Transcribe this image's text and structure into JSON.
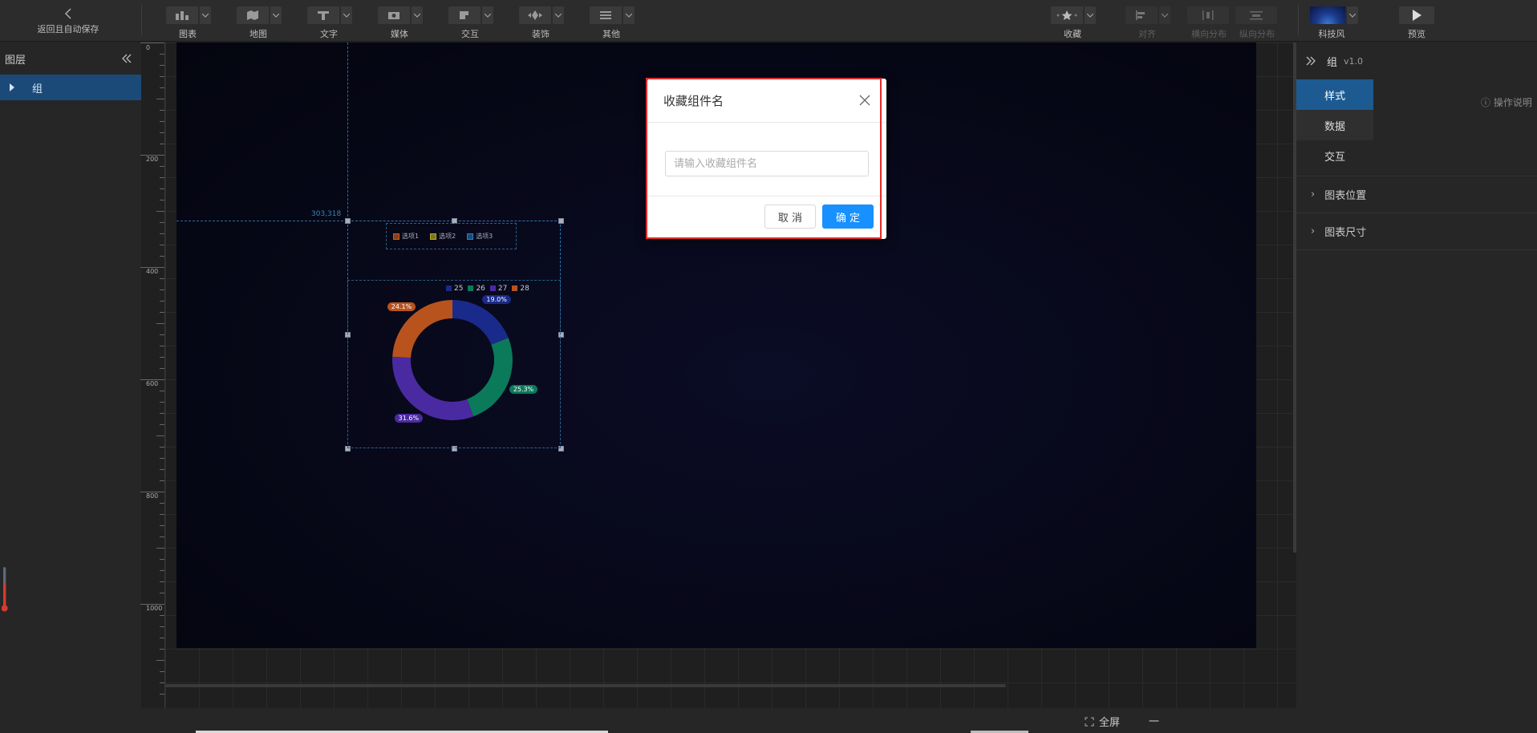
{
  "toolbar": {
    "back_label": "返回且自动保存",
    "groups": [
      {
        "label": "图表",
        "icon": "chart-icon"
      },
      {
        "label": "地图",
        "icon": "map-icon"
      },
      {
        "label": "文字",
        "icon": "text-icon"
      },
      {
        "label": "媒体",
        "icon": "media-icon"
      },
      {
        "label": "交互",
        "icon": "interact-icon"
      },
      {
        "label": "装饰",
        "icon": "decoration-icon"
      },
      {
        "label": "其他",
        "icon": "other-icon"
      }
    ],
    "right_groups": [
      {
        "label": "收藏",
        "icon": "star-icon"
      },
      {
        "label": "对齐",
        "icon": "align-icon"
      },
      {
        "label": "横向分布",
        "icon": "h-distribute-icon"
      },
      {
        "label": "纵向分布",
        "icon": "v-distribute-icon"
      },
      {
        "label": "科技风",
        "icon": "theme-thumbnail"
      },
      {
        "label": "预览",
        "icon": "play-icon"
      }
    ]
  },
  "layers": {
    "title": "图层",
    "items": [
      {
        "label": "组"
      }
    ]
  },
  "ruler": {
    "marks": [
      "0",
      "200",
      "400",
      "600",
      "800",
      "1000"
    ]
  },
  "canvas": {
    "coord_readout": "303,318",
    "legend_top": [
      {
        "label": "选项1",
        "color": "#c0602a"
      },
      {
        "label": "选项2",
        "color": "#b8a92c"
      },
      {
        "label": "选项3",
        "color": "#2b7fc4"
      }
    ]
  },
  "chart_data": {
    "type": "pie",
    "donut": true,
    "categories": [
      "25",
      "26",
      "27",
      "28"
    ],
    "values": [
      19.0,
      25.3,
      31.6,
      24.1
    ],
    "labels": [
      "19.0%",
      "25.3%",
      "31.6%",
      "24.1%"
    ],
    "colors": [
      "#1a2a8a",
      "#0b7a5a",
      "#4a2aa0",
      "#b8531e"
    ],
    "legend_position": "top"
  },
  "dialog": {
    "title": "收藏组件名",
    "input_placeholder": "请输入收藏组件名",
    "input_value": "",
    "cancel_label": "取 消",
    "ok_label": "确 定",
    "ok_color": "#1890ff"
  },
  "right_panel": {
    "title": "组",
    "version": "v1.0",
    "tabs": [
      {
        "label": "样式",
        "active": true
      },
      {
        "label": "数据",
        "active": false
      },
      {
        "label": "交互",
        "active": false
      }
    ],
    "help_label": "操作说明",
    "sections": [
      {
        "label": "图表位置"
      },
      {
        "label": "图表尺寸"
      }
    ]
  },
  "bottom": {
    "fullscreen_label": "全屏",
    "minus_label": "一"
  }
}
